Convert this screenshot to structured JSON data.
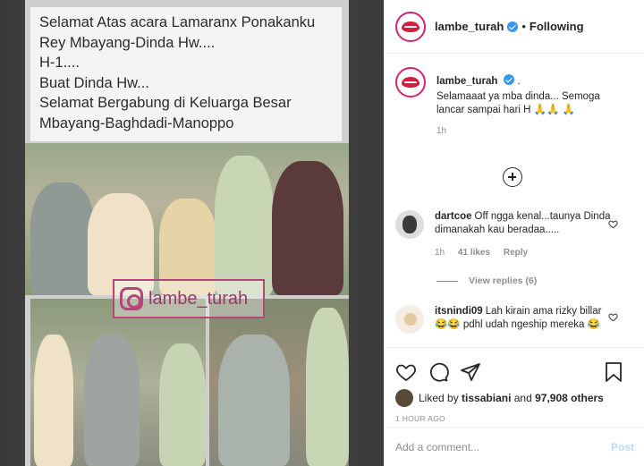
{
  "media": {
    "caption_lines": [
      "Selamat Atas acara Lamaranx Ponakanku",
      "Rey Mbayang-Dinda Hw....",
      "H-1....",
      "Buat Dinda Hw...",
      "Selamat Bergabung di Keluarga Besar",
      "Mbayang-Baghdadi-Manoppo"
    ],
    "watermark": "lambe_turah"
  },
  "header": {
    "username": "lambe_turah",
    "separator": "•",
    "follow_status": "Following"
  },
  "caption": {
    "username": "lambe_turah",
    "suffix": ".",
    "text": "Selamaaat ya mba dinda... Semoga lancar sampai hari H 🙏🙏 🙏",
    "time": "1h"
  },
  "comments": [
    {
      "username": "dartcoe",
      "text": "Off ngga kenal...taunya Dinda dimanakah kau beradaa.....",
      "time": "1h",
      "likes": "41 likes",
      "reply_label": "Reply",
      "view_replies": "View replies (6)"
    },
    {
      "username": "itsnindi09",
      "text": "Lah kirain ama rizky billar 😂😂 pdhl udah ngeship mereka 😂"
    }
  ],
  "likes": {
    "prefix": "Liked by",
    "user": "tissabiani",
    "middle": "and",
    "count": "97,908 others"
  },
  "time_ago": "1 HOUR AGO",
  "add_comment": {
    "placeholder": "Add a comment...",
    "post_label": "Post"
  },
  "colors": {
    "accent": "#3897f0",
    "brand_ring": "#d6246f",
    "post_disabled": "#b2dffc"
  }
}
